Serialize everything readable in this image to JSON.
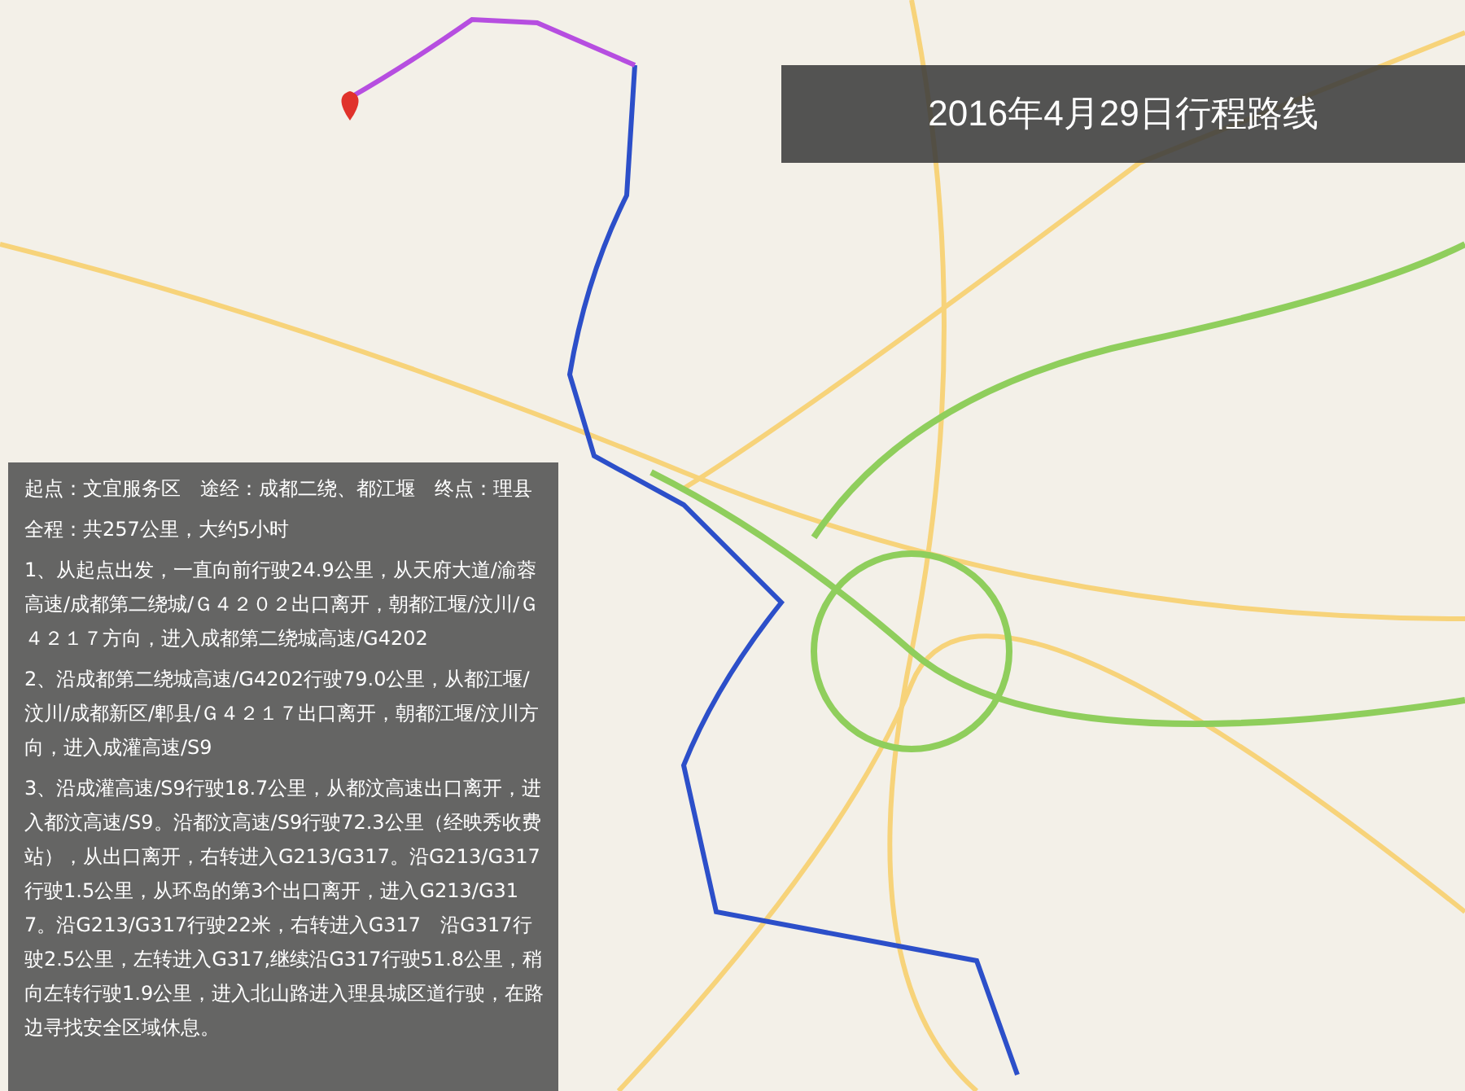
{
  "title": "2016年4月29日行程路线",
  "panel": {
    "summary": "起点：文宜服务区　途经：成都二绕、都江堰　终点：理县",
    "total": "全程：共257公里，大约5小时",
    "steps": [
      "1、从起点出发，一直向前行驶24.9公里，从天府大道/渝蓉高速/成都第二绕城/Ｇ４２０２出口离开，朝都江堰/汶川/Ｇ４２１７方向，进入成都第二绕城高速/G4202",
      "2、沿成都第二绕城高速/G4202行驶79.0公里，从都江堰/汶川/成都新区/郫县/Ｇ４２１７出口离开，朝都江堰/汶川方向，进入成灌高速/S9",
      "3、沿成灌高速/S9行驶18.7公里，从都汶高速出口离开，进入都汶高速/S9。沿都汶高速/S9行驶72.3公里（经映秀收费站），从出口离开，右转进入G213/G317。沿G213/G317行驶1.5公里，从环岛的第3个出口离开，进入G213/G317。沿G213/G317行驶22米，右转进入G317　沿G317行驶2.5公里，左转进入G317,继续沿G317行驶51.8公里，稍向左转行驶1.9公里，进入北山路进入理县城区道行驶，在路边寻找安全区域休息。"
    ]
  }
}
